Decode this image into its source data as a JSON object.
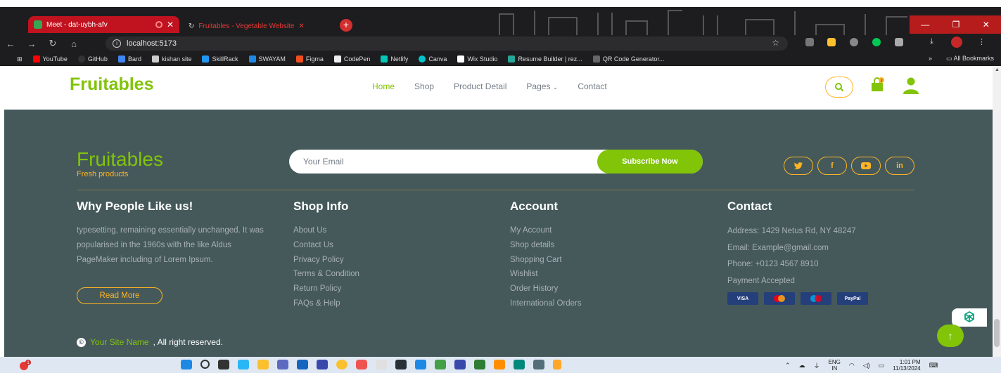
{
  "browser": {
    "active_tab_title": "Meet - dat-uybh-afv",
    "other_tab_title": "Fruitables - Vegetable Website",
    "url": "localhost:5173",
    "bookmarks": [
      "YouTube",
      "GitHub",
      "Bard",
      "kishan site",
      "SkillRack",
      "SWAYAM",
      "Figma",
      "CodePen",
      "Netlify",
      "Canva",
      "Wix Studio",
      "Resume Builder | rez...",
      "QR Code Generator..."
    ],
    "bookmarks_overflow": "»",
    "all_bookmarks": "All Bookmarks"
  },
  "navbar": {
    "brand": "Fruitables",
    "menu": [
      {
        "label": "Home",
        "active": true
      },
      {
        "label": "Shop",
        "active": false
      },
      {
        "label": "Product Detail",
        "active": false
      },
      {
        "label": "Pages",
        "active": false
      },
      {
        "label": "Contact",
        "active": false
      }
    ],
    "cart_count": "3"
  },
  "footer": {
    "brand": "Fruitables",
    "tagline": "Fresh products",
    "email_placeholder": "Your Email",
    "subscribe_label": "Subscribe Now",
    "socials": [
      "twitter-icon",
      "facebook-icon",
      "youtube-icon",
      "linkedin-icon"
    ],
    "columns": {
      "why": {
        "title": "Why People Like us!",
        "text": "typesetting, remaining essentially unchanged. It was popularised in the 1960s with the like Aldus PageMaker including of Lorem Ipsum.",
        "button": "Read More"
      },
      "shop": {
        "title": "Shop Info",
        "links": [
          "About Us",
          "Contact Us",
          "Privacy Policy",
          "Terms & Condition",
          "Return Policy",
          "FAQs & Help"
        ]
      },
      "account": {
        "title": "Account",
        "links": [
          "My Account",
          "Shop details",
          "Shopping Cart",
          "Wishlist",
          "Order History",
          "International Orders"
        ]
      },
      "contact": {
        "title": "Contact",
        "address": "Address: 1429 Netus Rd, NY 48247",
        "email": "Email: Example@gmail.com",
        "phone": "Phone: +0123 4567 8910",
        "payment_label": "Payment Accepted",
        "payments": [
          "VISA",
          "mastercard",
          "maestro",
          "PayPal"
        ]
      }
    },
    "copyright_site": "Your Site Name",
    "copyright_rest": ", All right reserved."
  },
  "taskbar": {
    "lang_line1": "ENG",
    "lang_line2": "IN",
    "time": "1:01 PM",
    "date": "11/13/2024",
    "notification_count": "1"
  },
  "colors": {
    "primary": "#81c408",
    "secondary": "#ffb524",
    "footer_bg": "#45595b"
  }
}
